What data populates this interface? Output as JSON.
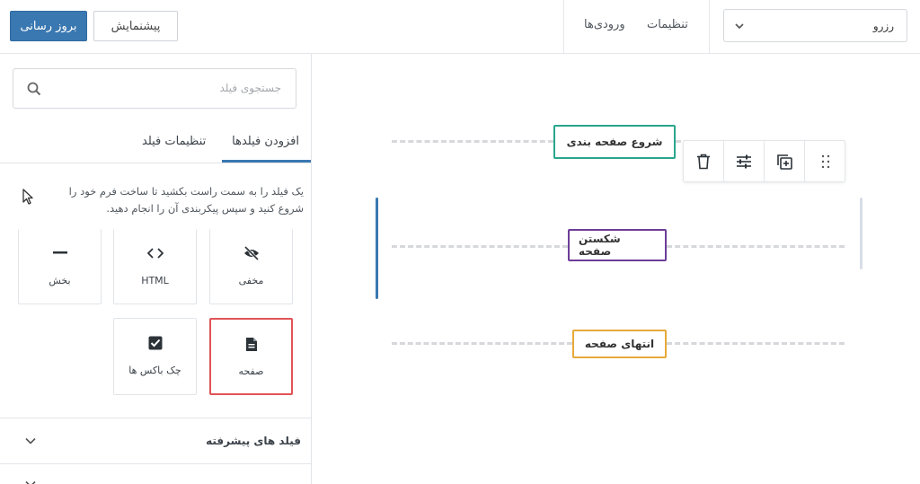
{
  "header": {
    "publish_label": "بروز رسانی",
    "preview_label": "پیشنمایش",
    "nav_entries": "ورودی‌ها",
    "nav_settings": "تنظیمات",
    "form_select_value": "رزرو",
    "accent_color": "#3a78b1"
  },
  "sidebar": {
    "search_placeholder": "جستجوی فیلد",
    "tabs": [
      {
        "label": "افزودن فیلدها",
        "active": true
      },
      {
        "label": "تنظیمات فیلد",
        "active": false
      }
    ],
    "hint_text": "یک فیلد را به سمت راست بکشید تا ساخت فرم خود را شروع کنید و سپس پیکربندی آن را انجام دهید.",
    "fields": [
      {
        "label": "مخفی",
        "icon": "eye-off-icon"
      },
      {
        "label": "HTML",
        "icon": "code-icon"
      },
      {
        "label": "بخش",
        "icon": "minus-icon"
      },
      {
        "label": "صفحه",
        "icon": "document-icon",
        "highlight_color": "#e15356"
      },
      {
        "label": "چک باکس ها",
        "icon": "checkbox-icon"
      }
    ],
    "accordion_advanced": "فیلد های پیشرفته"
  },
  "canvas": {
    "page_start": {
      "label": "شروع صفحه بندی",
      "color": "#2aa58d"
    },
    "page_break": {
      "label": "شکستن صفحه",
      "color": "#6e3d99"
    },
    "page_end": {
      "label": "انتهای صفحه",
      "color": "#e7a93b"
    },
    "toolbar_icons": [
      "trash-icon",
      "sliders-icon",
      "duplicate-icon",
      "drag-handle-icon"
    ]
  }
}
